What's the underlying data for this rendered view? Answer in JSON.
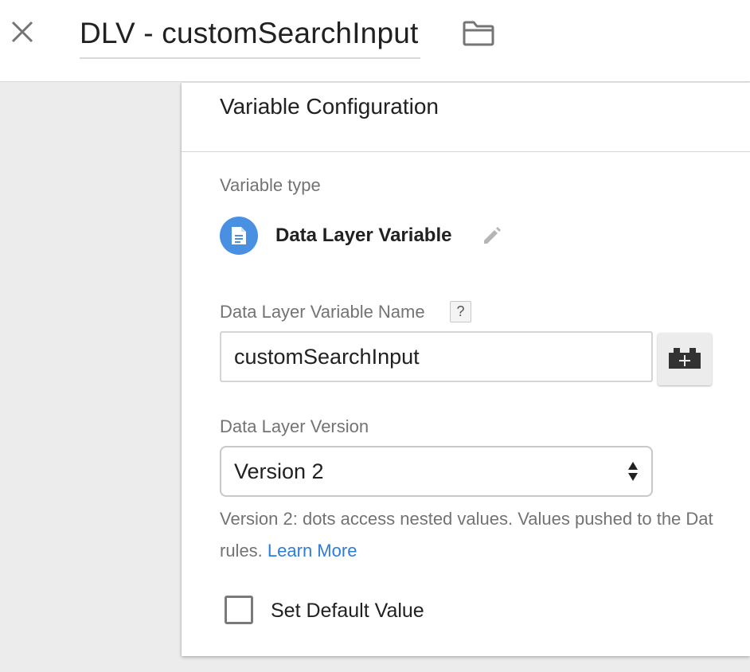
{
  "header": {
    "title": "DLV - customSearchInput",
    "close_icon": "close-icon",
    "folder_icon": "folder-icon"
  },
  "panel": {
    "title": "Variable Configuration",
    "variable_type": {
      "label": "Variable type",
      "name": "Data Layer Variable",
      "icon": "document-icon",
      "icon_color": "#4a90e2",
      "edit_icon": "pencil-icon"
    },
    "dlv_name": {
      "label": "Data Layer Variable Name",
      "help": "?",
      "value": "customSearchInput",
      "picker_icon": "variable-brick-add-icon"
    },
    "dl_version": {
      "label": "Data Layer Version",
      "selected": "Version 2",
      "help_line1": "Version 2: dots access nested values. Values pushed to the Dat",
      "help_line2_prefix": "rules. ",
      "learn_more": "Learn More",
      "link_color": "#2e7dd7"
    },
    "default_value": {
      "label": "Set Default Value",
      "checked": false
    }
  }
}
